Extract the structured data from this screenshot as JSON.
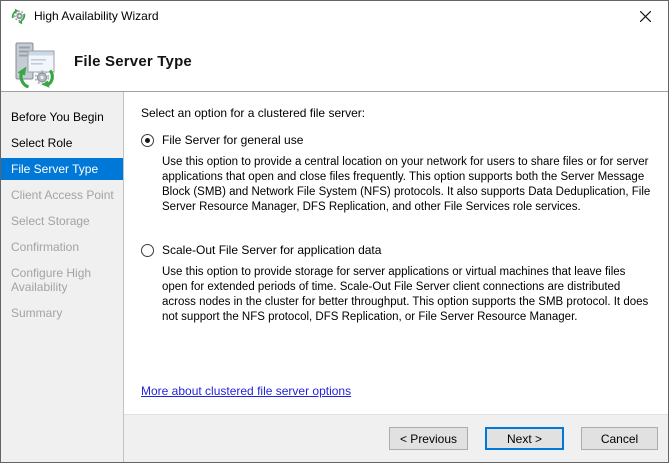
{
  "window": {
    "title": "High Availability Wizard"
  },
  "header": {
    "title": "File Server Type"
  },
  "icons": {
    "app_icon": "gear-with-green-sync-arrows",
    "header_icon": "server-with-green-sync-arrows-and-gear",
    "close_icon": "x-close-glyph"
  },
  "sidebar": {
    "items": [
      {
        "label": "Before You Begin",
        "state": "completed"
      },
      {
        "label": "Select Role",
        "state": "completed"
      },
      {
        "label": "File Server Type",
        "state": "current"
      },
      {
        "label": "Client Access Point",
        "state": "pending"
      },
      {
        "label": "Select Storage",
        "state": "pending"
      },
      {
        "label": "Confirmation",
        "state": "pending"
      },
      {
        "label": "Configure High Availability",
        "state": "pending"
      },
      {
        "label": "Summary",
        "state": "pending"
      }
    ]
  },
  "content": {
    "intro": "Select an option for a clustered file server:",
    "options": [
      {
        "label": "File Server for general use",
        "selected": true,
        "description": "Use this option to provide a central location on your network for users to share files or for server applications that open and close files frequently. This option supports both the Server Message Block (SMB) and Network File System (NFS) protocols. It also supports Data Deduplication, File Server Resource Manager, DFS Replication, and other File Services role services."
      },
      {
        "label": "Scale-Out File Server for application data",
        "selected": false,
        "description": "Use this option to provide storage for server applications or virtual machines that leave files open for extended periods of time. Scale-Out File Server client connections are distributed across nodes in the cluster for better throughput. This option supports the SMB protocol. It does not support the NFS protocol, DFS Replication, or File Server Resource Manager."
      }
    ],
    "link_label": "More about clustered file server options"
  },
  "footer": {
    "previous_label": "< Previous",
    "next_label": "Next >",
    "cancel_label": "Cancel"
  },
  "colors": {
    "accent": "#0078d7",
    "sidebar_bg": "#f0f0f0",
    "command_bar_bg": "#f0f0f0",
    "link": "#2323dd",
    "pending_step_text": "#a3a3a3",
    "button_face": "#e1e1e1",
    "button_border": "#adadad",
    "green_arrows": "#3aa746"
  }
}
